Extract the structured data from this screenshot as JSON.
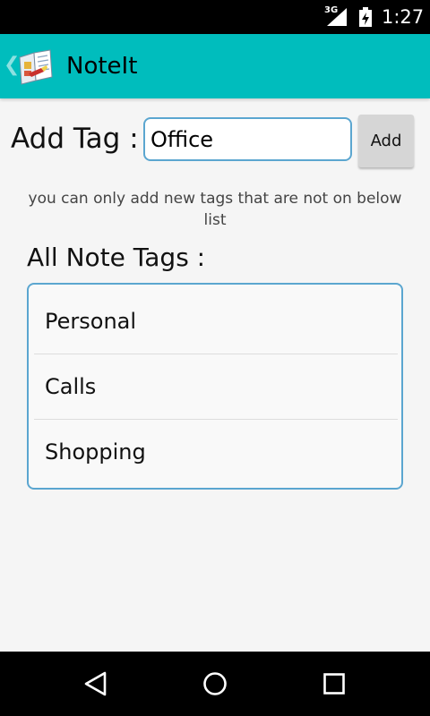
{
  "status_bar": {
    "network_type": "3G",
    "time": "1:27"
  },
  "action_bar": {
    "up_glyph": "❮",
    "title": "NoteIt",
    "icon": "notebook-icon"
  },
  "add_tag": {
    "label": "Add Tag :",
    "input_value": "Office",
    "button_label": "Add"
  },
  "hint": "you can only add new tags that are not on below list",
  "all_tags": {
    "title": "All Note Tags :",
    "items": [
      {
        "label": "Personal"
      },
      {
        "label": "Calls"
      },
      {
        "label": "Shopping"
      }
    ]
  },
  "colors": {
    "action_bar": "#00bdbd",
    "field_border": "#5ba6d0",
    "button_bg": "#d6d6d6",
    "background": "#f5f5f5"
  },
  "nav_icons": [
    "back-icon",
    "home-icon",
    "recents-icon"
  ]
}
